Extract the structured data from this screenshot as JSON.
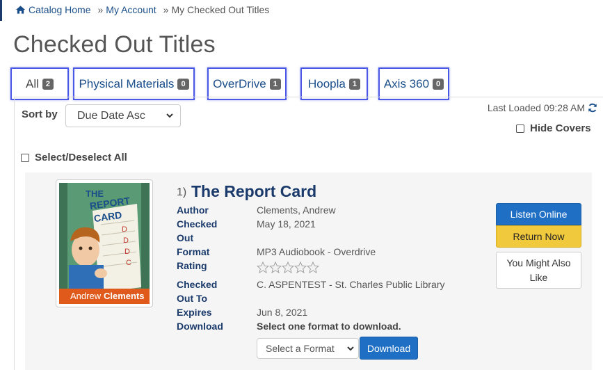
{
  "breadcrumb": {
    "home": "Catalog Home",
    "sep1": "»",
    "account": "My Account",
    "sep2": "»",
    "current": "My Checked Out Titles"
  },
  "page_title": "Checked Out Titles",
  "tabs": [
    {
      "label": "All",
      "count": "2",
      "active": true
    },
    {
      "label": "Physical Materials",
      "count": "0",
      "active": false
    },
    {
      "label": "OverDrive",
      "count": "1",
      "active": false
    },
    {
      "label": "Hoopla",
      "count": "1",
      "active": false
    },
    {
      "label": "Axis 360",
      "count": "0",
      "active": false
    }
  ],
  "sort": {
    "label": "Sort by",
    "value": "Due Date Asc"
  },
  "last_loaded": "Last Loaded 09:28 AM",
  "hide_covers": "Hide Covers",
  "select_all": "Select/Deselect All",
  "item": {
    "number": "1)",
    "title": "The Report Card",
    "cover": {
      "title_line1": "THE",
      "title_line2": "REPORT",
      "title_line3": "CARD",
      "author_first": "Andrew",
      "author_last": "Clements"
    },
    "fields": [
      {
        "label": "Author",
        "value": "Clements, Andrew"
      },
      {
        "label": "Checked Out",
        "value": "May 18, 2021"
      },
      {
        "label": "Format",
        "value": "MP3 Audiobook - Overdrive"
      },
      {
        "label": "Rating",
        "value": ""
      },
      {
        "label": "Checked Out To",
        "value": "C. ASPENTEST - St. Charles Public Library"
      },
      {
        "label": "Expires",
        "value": "Jun 8, 2021"
      },
      {
        "label": "Download",
        "value": "Select one format to download."
      }
    ],
    "rating_stars": 0,
    "format_select": "Select a Format",
    "download_btn": "Download",
    "listen_btn": "Listen Online",
    "return_btn": "Return Now",
    "similar_btn": "You Might Also Like"
  },
  "colors": {
    "accent_blue": "#1f6fc5",
    "return_yellow": "#f0c93c",
    "title_navy": "#1a3a6b",
    "tab_highlight": "#4a58e6"
  }
}
